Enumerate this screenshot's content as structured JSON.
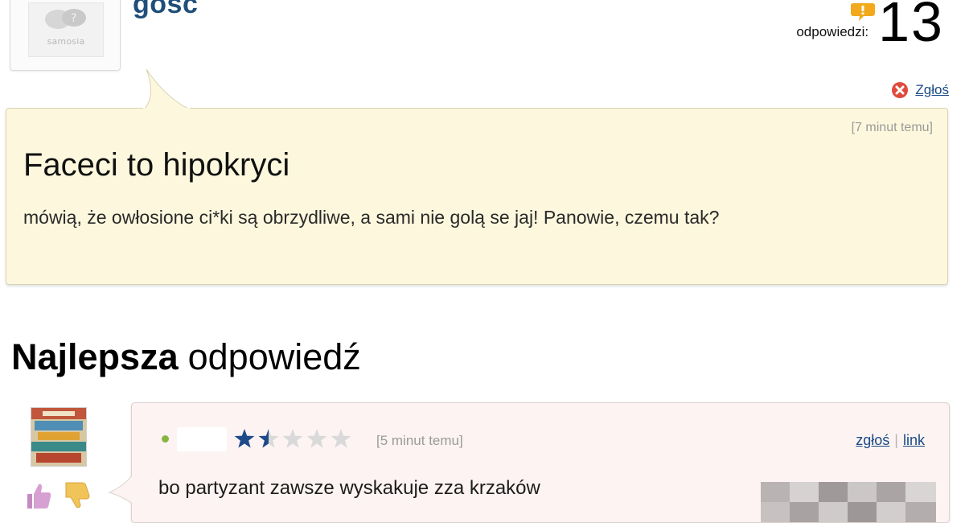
{
  "header": {
    "avatar_logo_text": "samosia",
    "username": "gosc",
    "answers_label": "odpowiedzi:",
    "answers_count": "13",
    "report_label": "Zgłoś"
  },
  "question": {
    "time": "[7 minut temu]",
    "title": "Faceci to hipokryci",
    "body": "mówią, że owłosione ci*ki są obrzydliwe, a sami nie golą se jaj! Panowie, czemu tak?"
  },
  "best_answer": {
    "heading_strong": "Najlepsza",
    "heading_rest": "odpowiedź",
    "rating": 1.5,
    "rating_max": 5,
    "time": "[5 minut temu]",
    "report_label": "zgłoś",
    "separator": "|",
    "link_label": "link",
    "text": "bo partyzant zawsze wyskakuje zza krzaków"
  },
  "colors": {
    "question_bg": "#fdf8dd",
    "answer_bg": "#fcf3f2",
    "link": "#1a4a85",
    "username": "#1f4f7a",
    "star_filled": "#1f4a8a",
    "star_empty": "#d9d9d9",
    "status_dot": "#8ab440",
    "report_icon": "#e04b3c"
  },
  "icons": {
    "answers": "answer-bubble-icon",
    "report": "close-circle-icon",
    "thumb_up": "thumb-up-icon",
    "thumb_down": "thumb-down-icon",
    "star": "star-icon"
  }
}
